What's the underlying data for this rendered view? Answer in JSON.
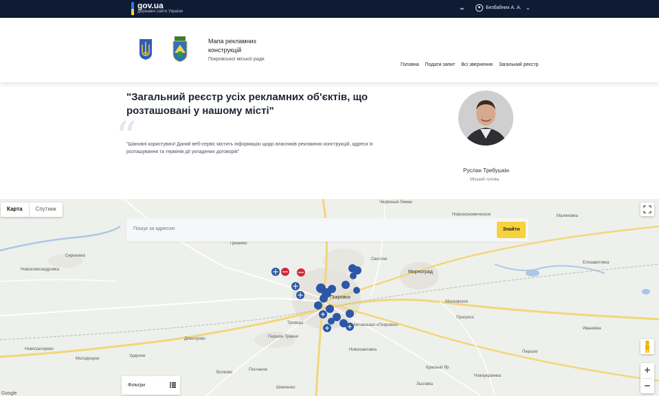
{
  "govbar": {
    "logo": "gov.ua",
    "subtitle": "Державні сайти України",
    "user_name": "Безбабних А. А."
  },
  "header": {
    "title": "Мапа рекламних конструкцій",
    "subtitle": "Покровської міської ради",
    "nav": [
      "Головна",
      "Подати запит",
      "Всі звернення",
      "Загальний реєстр"
    ]
  },
  "intro": {
    "quote": "\"Загальний реєстр усіх рекламних об'єктів, що розташовані у нашому місті\"",
    "text": "\"Шановні користувачі! Даний веб-сервіс містить інформацію щодо власників рекламних конструкцій, адреси їх розташування та термінів дії укладених договорів\"",
    "mayor_name": "Руслан Требушкін",
    "mayor_role": "Міський голова"
  },
  "map": {
    "type_buttons": [
      "Карта",
      "Спутник"
    ],
    "search_placeholder": "Пошук за адресою",
    "search_button": "Знайти",
    "filters_label": "Фільтри",
    "zoom_in": "+",
    "zoom_out": "−",
    "google": "Google",
    "place_labels": [
      "Червоный Лиман",
      "Новоэкономическое",
      "Малиновка",
      "Гришино",
      "Светлое",
      "Мирноград",
      "Елизаветовка",
      "Сергеевка",
      "Новоалександровка",
      "Московское",
      "Прогресс",
      "Покровск",
      "Ивановка",
      "Троянда",
      "Автовокзал «Покровск»",
      "Першое Травня",
      "Димитрово",
      "Новопавловка",
      "Новограторево",
      "Молодецкое",
      "Ударное",
      "Красный Яр",
      "Волково",
      "Песчаное",
      "Шевченко",
      "Лысовка",
      "Новоукраинка",
      "Першое"
    ],
    "colors": {
      "pin": "#2b57a6",
      "pin_red": "#d3283b",
      "accent": "#f6d33a"
    }
  }
}
